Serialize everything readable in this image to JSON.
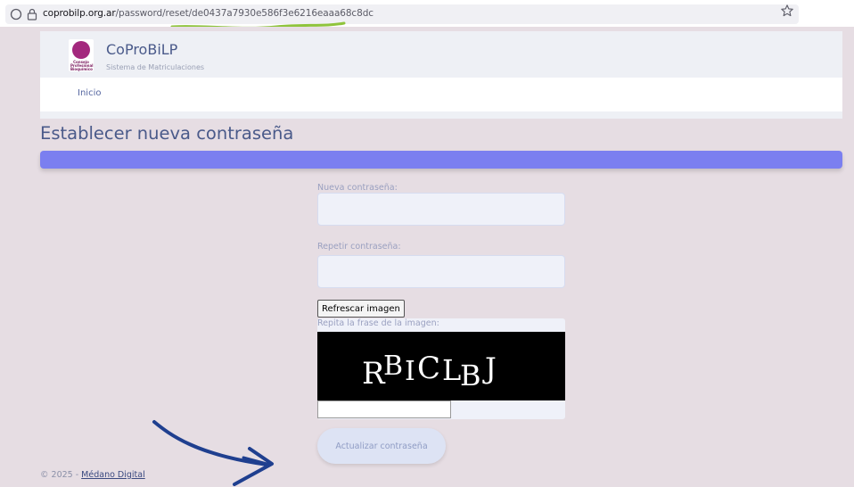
{
  "browser": {
    "url_domain": "coprobilp.org.ar",
    "url_path": "/password/reset/de0437a7930e586f3e6216eaaa68c8dc"
  },
  "header": {
    "brand_name": "CoProBiLP",
    "brand_subtitle": "Sistema de Matriculaciones",
    "logo_text": "Consejo Profesional Bioquímico"
  },
  "nav": {
    "items": [
      {
        "label": "Inicio"
      }
    ]
  },
  "page": {
    "title": "Establecer nueva contraseña"
  },
  "form": {
    "new_password_label": "Nueva contraseña:",
    "repeat_password_label": "Repetir contraseña:",
    "refresh_button_label": "Refrescar imagen",
    "captcha_label": "Repita la frase de la imagen:",
    "captcha_text": "RBICLBJ",
    "submit_label": "Actualizar contraseña"
  },
  "footer": {
    "prefix": "© 2025 - ",
    "link_text": "Médano Digital"
  },
  "colors": {
    "accent_bar": "#7b7ff0",
    "brand_text": "#4a5a8a",
    "annotation_arrow": "#1f3f8f",
    "annotation_underline": "#8fc43c"
  }
}
